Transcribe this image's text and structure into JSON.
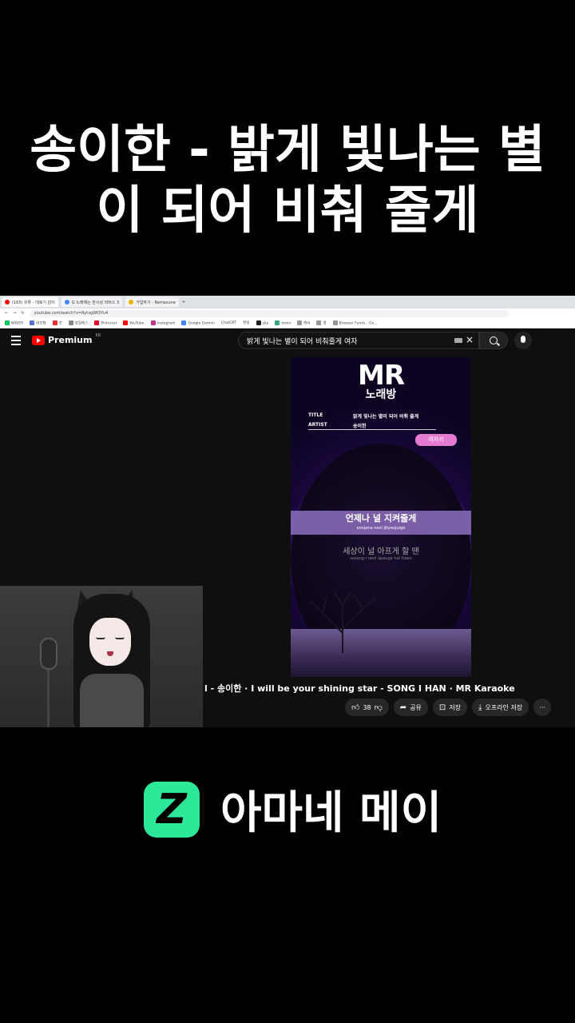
{
  "headline": {
    "line1": "송이한 - 밝게 빛나는 별",
    "line2": "이 되어 비춰 줄게"
  },
  "browser": {
    "tabs": [
      {
        "label": "(165) 유튜 - 데로기 감이",
        "color": "#ff0000"
      },
      {
        "label": "G 노래에는 한시상 리버스 3",
        "color": "#4285f4"
      },
      {
        "label": "가입하기 - Remsoune",
        "color": "#f4b400"
      }
    ],
    "url": "youtube.com/watch?v=RytvgWt5Yu4",
    "bookmarks": [
      "NAVER",
      "대보험",
      "조",
      "당필에스",
      "Pinterest",
      "YouTube",
      "Instagram",
      "Google Gemini",
      "ChatGPT",
      "텐실",
      "yku",
      "tomo",
      "백서",
      "앰",
      "Browser Funds - Go..."
    ]
  },
  "youtube": {
    "brand": "Premium",
    "region": "KR",
    "search_query": "밝게 빛나는 별이 되어 비춰줄게 여자",
    "video_title": "l - 송이한 · I will be your shining star - SONG I HAN · MR Karaoke",
    "like_count": "38",
    "share_label": "공유",
    "save_label": "저장",
    "offline_label": "오프라인 저장",
    "more_label": "···"
  },
  "video": {
    "logo_top": "MR",
    "logo_bottom": "노래방",
    "title_key": "TITLE",
    "title_value": "밝게 빛나는 별이 되어 비춰 줄게",
    "artist_key": "ARTIST",
    "artist_value": "송이한",
    "key_tag": "여자키",
    "lyric_current": "언제나 널 지켜줄게",
    "lyric_current_rom": "eonjena neol jikyeojulge",
    "lyric_next": "세상이 널 아프게 할 땐",
    "lyric_next_rom": "sesang-i neol apeuge hal ttaen"
  },
  "brand": {
    "name": "아마네 메이",
    "accent": "#2ee89a"
  }
}
